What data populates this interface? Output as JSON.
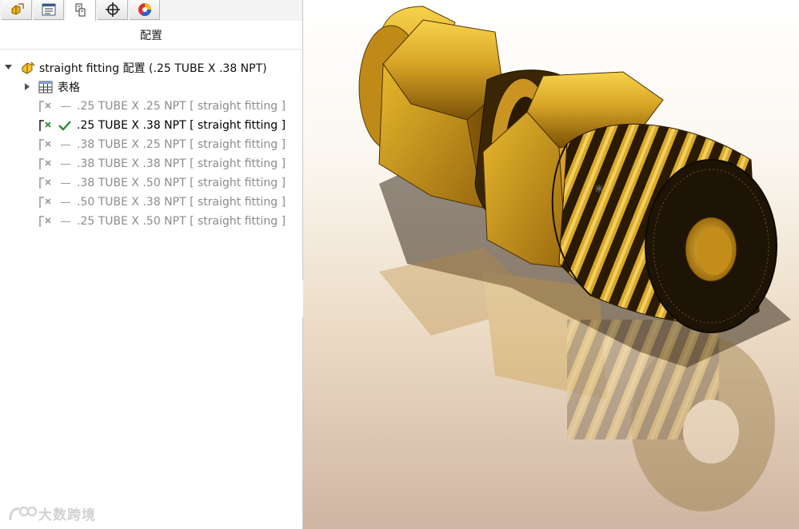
{
  "panel": {
    "tabs": [
      {
        "icon": "feature-manager-icon"
      },
      {
        "icon": "property-manager-icon"
      },
      {
        "icon": "configuration-manager-icon",
        "active": true
      },
      {
        "icon": "dimxpert-icon"
      },
      {
        "icon": "display-manager-icon"
      }
    ],
    "title": "配置",
    "root": {
      "label": "straight fitting 配置  (.25 TUBE X .38 NPT)"
    },
    "table": {
      "label": "表格"
    },
    "configurations": [
      {
        "label": ".25 TUBE X .25 NPT [ straight fitting ]",
        "active": false
      },
      {
        "label": ".25 TUBE X .38 NPT [ straight fitting ]",
        "active": true
      },
      {
        "label": ".38 TUBE X .25 NPT [ straight fitting ]",
        "active": false
      },
      {
        "label": ".38 TUBE X .38 NPT [ straight fitting ]",
        "active": false
      },
      {
        "label": ".38 TUBE X .50 NPT [ straight fitting ]",
        "active": false
      },
      {
        "label": ".50 TUBE X .38 NPT [ straight fitting ]",
        "active": false
      },
      {
        "label": ".25 TUBE X .50 NPT [ straight fitting ]",
        "active": false
      }
    ]
  },
  "watermark": {
    "text": "大数跨境"
  },
  "colors": {
    "brass_light": "#f2c93a",
    "brass_mid": "#c8901a",
    "brass_dark": "#6e4808",
    "active_check": "#2e8b2e"
  }
}
